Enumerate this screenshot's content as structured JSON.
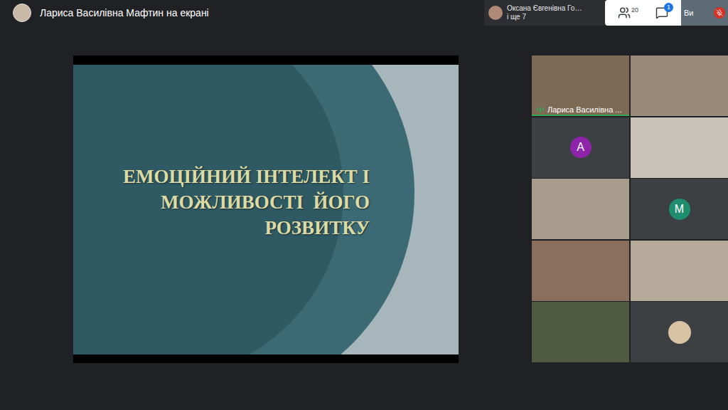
{
  "header": {
    "presenter": "Лариса Василівна Мафтин на екрані"
  },
  "notification": {
    "name": "Оксана Євгенівна Го…",
    "more": "і ще 7"
  },
  "participants": {
    "count": "20"
  },
  "chat": {
    "badge": "1"
  },
  "self": {
    "label": "Ви",
    "muted": true
  },
  "slide": {
    "title_lines": [
      "ЕМОЦІЙНИЙ ІНТЕЛЕКТ І",
      "МОЖЛИВОСТІ  ЙОГО",
      "РОЗВИТКУ"
    ]
  },
  "tiles": [
    {
      "kind": "video",
      "color": "#7d6a55",
      "label": "Лариса Василівна ...",
      "speaking": true
    },
    {
      "kind": "video",
      "color": "#9a8a7a",
      "speaking": false
    },
    {
      "kind": "avatar",
      "letter": "A",
      "color": "#8e24aa",
      "speaking": false
    },
    {
      "kind": "video",
      "color": "#c9c2b8",
      "speaking": false
    },
    {
      "kind": "video",
      "color": "#a89a8c",
      "speaking": false
    },
    {
      "kind": "avatar",
      "letter": "M",
      "color": "#1e8e6e",
      "speaking": false
    },
    {
      "kind": "video",
      "color": "#8a6e5e",
      "speaking": false
    },
    {
      "kind": "video",
      "color": "#b5a99a",
      "speaking": false
    },
    {
      "kind": "video",
      "color": "#4f5a40",
      "speaking": false
    },
    {
      "kind": "photo-avatar",
      "color": "#d8c3a5",
      "speaking": false
    }
  ]
}
